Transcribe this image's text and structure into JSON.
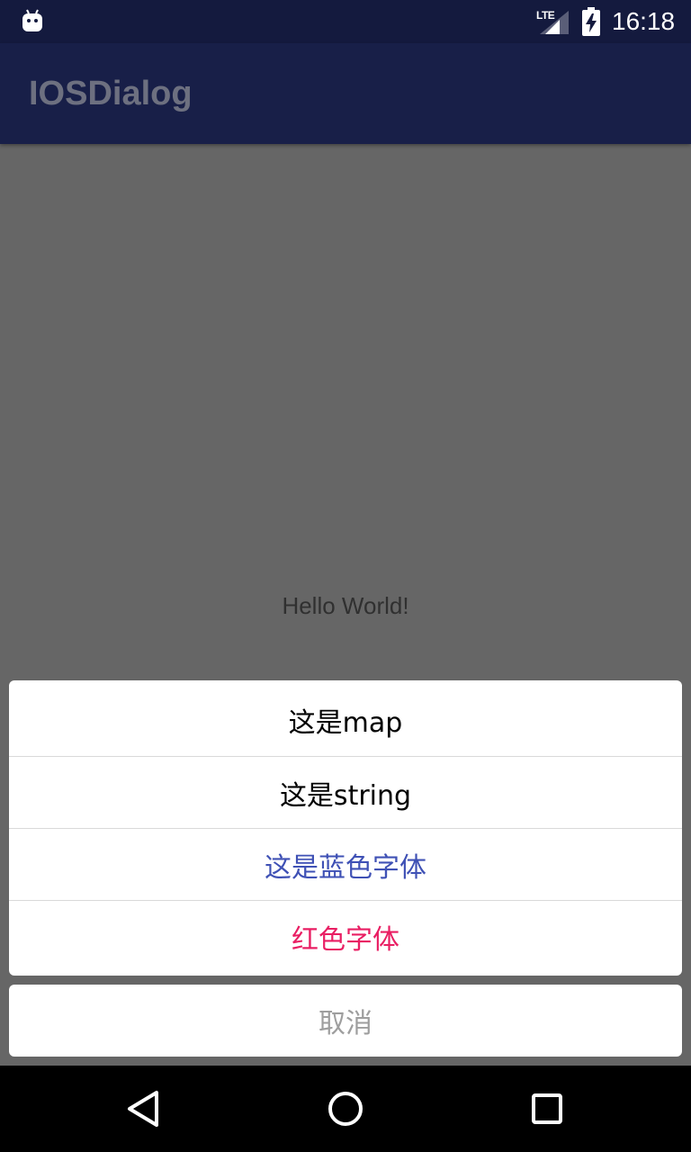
{
  "status_bar": {
    "network": "LTE",
    "time": "16:18",
    "icons": [
      "android-icon",
      "signal-icon",
      "battery-charging-icon"
    ]
  },
  "app_bar": {
    "title": "IOSDialog"
  },
  "content": {
    "text": "Hello World!"
  },
  "action_sheet": {
    "items": [
      {
        "label": "这是map",
        "color": "#000000"
      },
      {
        "label": "这是string",
        "color": "#000000"
      },
      {
        "label": "这是蓝色字体",
        "color": "#3f51b5"
      },
      {
        "label": "红色字体",
        "color": "#e91e63"
      }
    ],
    "cancel": {
      "label": "取消",
      "color": "#9e9e9e"
    }
  },
  "nav_bar": {
    "icons": [
      "back-icon",
      "home-icon",
      "recents-icon"
    ]
  },
  "colors": {
    "status_bar": "#141a3e",
    "app_bar": "#181f48",
    "scrim_background": "#666666"
  }
}
